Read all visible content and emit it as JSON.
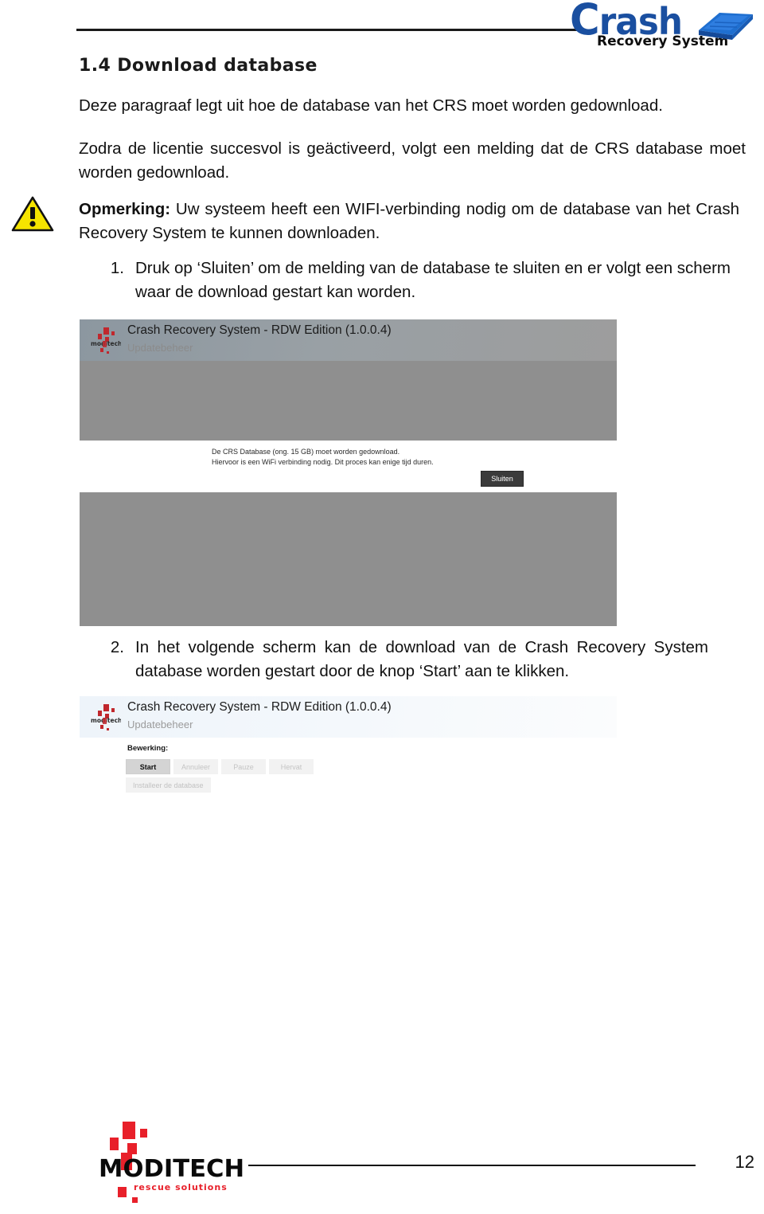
{
  "brand": {
    "logo_main": "rash",
    "logo_cap": "C",
    "logo_sub": "Recovery System",
    "accent_blue": "#1a4fa0"
  },
  "document": {
    "heading": "1.4 Download database",
    "intro": "Deze paragraaf legt uit hoe de database van het CRS moet worden gedownload.",
    "paragraph_activation": "Zodra de licentie succesvol is geäctiveerd, volgt een melding dat de CRS database moet worden gedownload.",
    "note_label": "Opmerking:",
    "note_text": " Uw systeem heeft een WIFI-verbinding nodig om de database van het Crash Recovery System te kunnen downloaden.",
    "steps": [
      {
        "number": "1.",
        "text": "Druk op ‘Sluiten’ om de melding van de database te sluiten en er volgt een scherm waar de download gestart kan worden."
      },
      {
        "number": "2.",
        "text": "In het volgende scherm kan de download van de Crash Recovery System database worden gestart door de knop ‘Start’ aan te klikken."
      }
    ]
  },
  "screenshot_one": {
    "app_title": "Crash Recovery System - RDW Edition (1.0.0.4)",
    "app_subtitle": "Updatebeheer",
    "dialog_line_1": "De CRS Database (ong. 15 GB) moet worden gedownload.",
    "dialog_line_2": "Hiervoor is een WiFi verbinding nodig. Dit proces kan enige tijd duren.",
    "close_button": "Sluiten"
  },
  "screenshot_two": {
    "app_title": "Crash Recovery System - RDW Edition (1.0.0.4)",
    "app_subtitle": "Updatebeheer",
    "operation_label": "Bewerking:",
    "buttons": [
      {
        "label": "Start",
        "enabled": true
      },
      {
        "label": "Annuleer",
        "enabled": false
      },
      {
        "label": "Pauze",
        "enabled": false
      },
      {
        "label": "Hervat",
        "enabled": false
      }
    ],
    "install_button": "Installeer de database"
  },
  "footer": {
    "company": "MODITECH",
    "tagline": "rescue solutions",
    "page_number": "12",
    "accent_red": "#e8202a"
  }
}
